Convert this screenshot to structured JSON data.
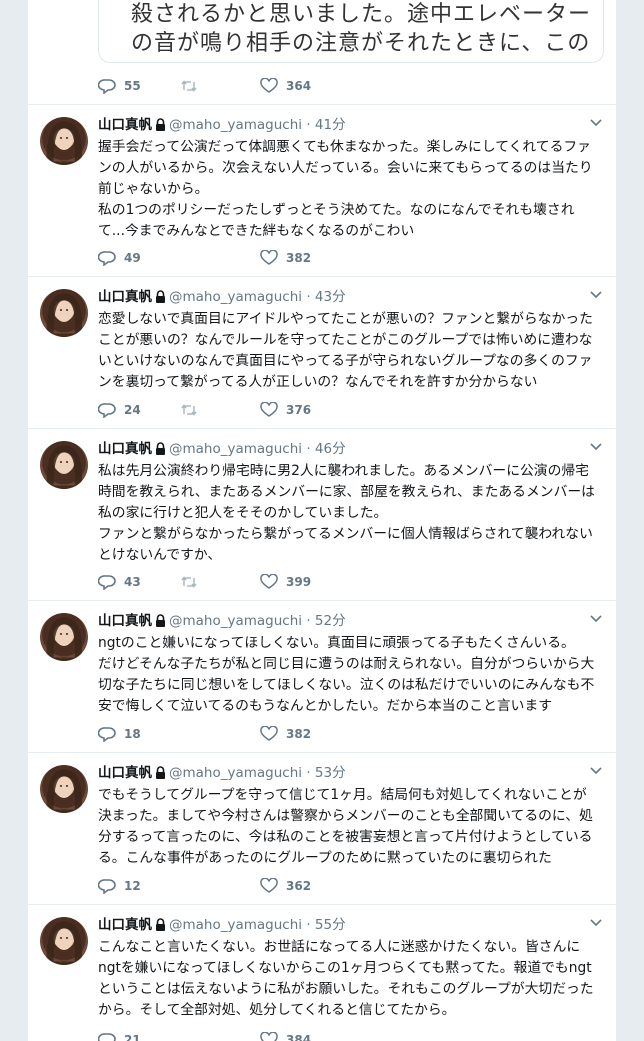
{
  "quote_fragment": {
    "lines": [
      "殺されるかと思いました。途中エレベーター",
      "の音が鳴り相手の注意がそれたときに、この"
    ]
  },
  "first_actions": {
    "replies": "55",
    "likes": "364"
  },
  "tweets": [
    {
      "name": "山口真帆",
      "handle": "@maho_yamaguchi",
      "dot": "·",
      "time": "41分",
      "lines": [
        "握手会だって公演だって体調悪くても休まなかった。楽しみにしてくれてるファ",
        "ンの人がいるから。次会えない人だっている。会いに来てもらってるのは当たり",
        "前じゃないから。",
        "私の1つのポリシーだったしずっとそう決めてた。なのになんでそれも壊され",
        "て...今までみんなとできた絆もなくなるのがこわい"
      ],
      "replies": "49",
      "likes": "382"
    },
    {
      "name": "山口真帆",
      "handle": "@maho_yamaguchi",
      "dot": "·",
      "time": "43分",
      "lines": [
        "恋愛しないで真面目にアイドルやってたことが悪いの？ファンと繋がらなかった",
        "ことが悪いの？なんでルールを守ってたことがこのグループでは怖いめに遭わな",
        "いといけないのなんで真面目にやってる子が守られないグループなの多くのファ",
        "ンを裏切って繋がってる人が正しいの？なんでそれを許すか分からない"
      ],
      "replies": "24",
      "likes": "376"
    },
    {
      "name": "山口真帆",
      "handle": "@maho_yamaguchi",
      "dot": "·",
      "time": "46分",
      "lines": [
        "私は先月公演終わり帰宅時に男2人に襲われました。あるメンバーに公演の帰宅",
        "時間を教えられ、またあるメンバーに家、部屋を教えられ、またあるメンバーは",
        "私の家に行けと犯人をそそのかしていました。",
        "ファンと繋がらなかったら繋がってるメンバーに個人情報ばらされて襲われない",
        "とけないんですか、"
      ],
      "replies": "43",
      "likes": "399"
    },
    {
      "name": "山口真帆",
      "handle": "@maho_yamaguchi",
      "dot": "·",
      "time": "52分",
      "lines": [
        "ngtのこと嫌いになってほしくない。真面目に頑張ってる子もたくさんいる。",
        "だけどそんな子たちが私と同じ目に遭うのは耐えられない。自分がつらいから大",
        "切な子たちに同じ想いをしてほしくない。泣くのは私だけでいいのにみんなも不",
        "安で悔しくて泣いてるのもうなんとかしたい。だから本当のこと言います"
      ],
      "replies": "18",
      "likes": "382"
    },
    {
      "name": "山口真帆",
      "handle": "@maho_yamaguchi",
      "dot": "·",
      "time": "53分",
      "lines": [
        "でもそうしてグループを守って信じて1ヶ月。結局何も対処してくれないことが",
        "決まった。ましてや今村さんは警察からメンバーのことも全部聞いてるのに、処",
        "分するって言ったのに、今は私のことを被害妄想と言って片付けようとしている",
        "る。こんな事件があったのにグループのために黙っていたのに裏切られた"
      ],
      "replies": "12",
      "likes": "362"
    },
    {
      "name": "山口真帆",
      "handle": "@maho_yamaguchi",
      "dot": "·",
      "time": "55分",
      "lines": [
        "こんなこと言いたくない。お世話になってる人に迷惑かけたくない。皆さんに",
        "ngtを嫌いになってほしくないからこの1ヶ月つらくても黙ってた。報道でもngt",
        "ということは伝えないように私がお願いした。それもこのグループが大切だった",
        "から。そして全部対処、処分してくれると信じてたから。"
      ],
      "replies": "21",
      "likes": "384"
    }
  ]
}
